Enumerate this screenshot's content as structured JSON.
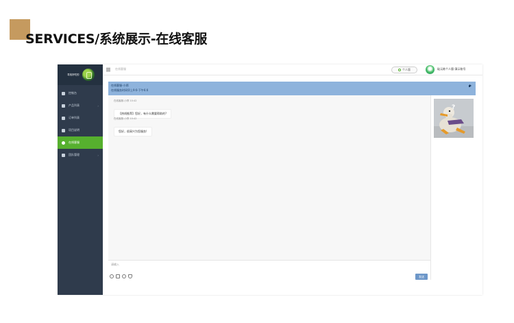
{
  "slide": {
    "title": "SERVICES/系统展示-在线客服",
    "accent_color": "#c59a5f"
  },
  "sidebar": {
    "logo_text": "寻找好吃的",
    "items": [
      {
        "label": "控制台",
        "icon": "home-icon",
        "active": false
      },
      {
        "label": "产品列表",
        "icon": "grid-icon",
        "active": false,
        "has_caret": true
      },
      {
        "label": "订单列表",
        "icon": "cart-icon",
        "active": false
      },
      {
        "label": "项目说明",
        "icon": "doc-icon",
        "active": false
      },
      {
        "label": "在线客服",
        "icon": "user-icon",
        "active": true
      },
      {
        "label": "团队管理",
        "icon": "team-icon",
        "active": false,
        "has_caret": true
      }
    ],
    "active_color": "#56b02e"
  },
  "topbar": {
    "search_placeholder": "在线客服",
    "personal_label": "个人版",
    "username": "硅元练个人版-演示账号"
  },
  "chat": {
    "header_line1": "在线客服-小郑",
    "header_line2": "在线服务时间早上9:0-下午6:0",
    "header_color": "#8eb3dc",
    "messages": [
      {
        "meta": "在线客服-小郑 10:42",
        "text": "【热线推荐】您好，有什么需要帮助的?"
      },
      {
        "meta": "在线客服-小郑 10:42",
        "text": "您好，很高兴为您服务!"
      }
    ],
    "input_placeholder": "请输入",
    "send_label": "发送",
    "send_color": "#6d97c9",
    "toolbar_icons": [
      "emoji-icon",
      "image-icon",
      "clock-icon",
      "thumbs-up-icon"
    ]
  }
}
